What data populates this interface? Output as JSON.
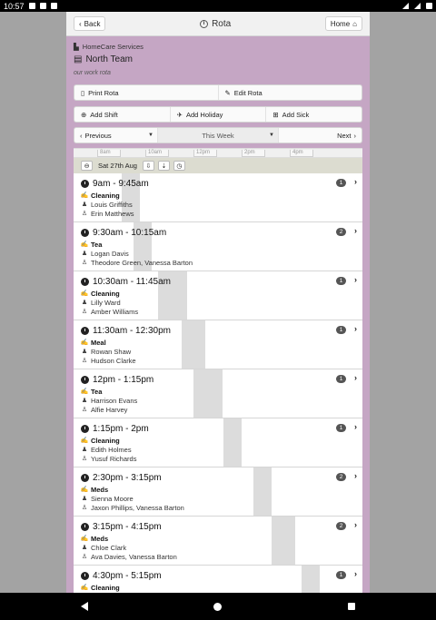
{
  "statusbar": {
    "time": "10:57"
  },
  "header": {
    "back_label": "Back",
    "title": "Rota",
    "home_label": "Home"
  },
  "meta": {
    "company": "HomeCare Services",
    "team": "North Team",
    "description": "our work rota"
  },
  "actions": {
    "print": "Print Rota",
    "edit": "Edit Rota",
    "add_shift": "Add Shift",
    "add_holiday": "Add Holiday",
    "add_sick": "Add Sick"
  },
  "nav": {
    "previous": "Previous",
    "week": "This Week",
    "next": "Next"
  },
  "timeline": {
    "ticks": [
      "8am",
      "10am",
      "12pm",
      "2pm",
      "4pm"
    ]
  },
  "day": {
    "label": "Sat 27th Aug"
  },
  "shifts": [
    {
      "time": "9am - 9:45am",
      "type": "Cleaning",
      "client": "Louis Griffiths",
      "staff": "Erin Matthews",
      "count": "1"
    },
    {
      "time": "9:30am - 10:15am",
      "type": "Tea",
      "client": "Logan Davis",
      "staff": "Theodore Green, Vanessa Barton",
      "count": "2"
    },
    {
      "time": "10:30am - 11:45am",
      "type": "Cleaning",
      "client": "Lilly Ward",
      "staff": "Amber Williams",
      "count": "1"
    },
    {
      "time": "11:30am - 12:30pm",
      "type": "Meal",
      "client": "Rowan Shaw",
      "staff": "Hudson Clarke",
      "count": "1"
    },
    {
      "time": "12pm - 1:15pm",
      "type": "Tea",
      "client": "Harrison Evans",
      "staff": "Alfie Harvey",
      "count": "1"
    },
    {
      "time": "1:15pm - 2pm",
      "type": "Cleaning",
      "client": "Edith Holmes",
      "staff": "Yusuf Richards",
      "count": "1"
    },
    {
      "time": "2:30pm - 3:15pm",
      "type": "Meds",
      "client": "Sienna Moore",
      "staff": "Jaxon Phillips, Vanessa Barton",
      "count": "2"
    },
    {
      "time": "3:15pm - 4:15pm",
      "type": "Meds",
      "client": "Chloe Clark",
      "staff": "Ava Davies, Vanessa Barton",
      "count": "2"
    },
    {
      "time": "4:30pm - 5:15pm",
      "type": "Cleaning",
      "client": "",
      "staff": "",
      "count": "1"
    }
  ]
}
